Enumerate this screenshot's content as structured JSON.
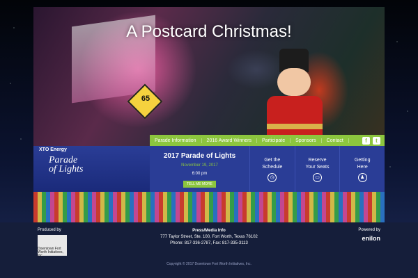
{
  "hero": {
    "title": "A Postcard Christmas!",
    "sign_number": "65"
  },
  "nav": {
    "items": [
      "Parade Information",
      "2016 Award Winners",
      "Participate",
      "Sponsors",
      "Contact"
    ],
    "social": [
      "f",
      "t"
    ]
  },
  "logo": {
    "sponsor": "XTO Energy",
    "name_line1": "Parade",
    "name_line2": "of Lights"
  },
  "event": {
    "title": "2017 Parade of Lights",
    "date": "November 19, 2017",
    "time": "6:00 pm",
    "button": "TELL ME MORE"
  },
  "tiles": [
    {
      "label1": "Get the",
      "label2": "Schedule",
      "icon": "clock-icon"
    },
    {
      "label1": "Reserve",
      "label2": "Your Seats",
      "icon": "ticket-icon"
    },
    {
      "label1": "Getting",
      "label2": "Here",
      "icon": "person-icon"
    }
  ],
  "footer": {
    "produced_by": "Produced by",
    "dfw": "Downtown Fort Worth Initiatives, Inc.",
    "press_title": "Press/Media Info",
    "address": "777 Taylor Street, Ste. 100, Fort Worth, Texas 76102",
    "phone": "Phone: 817-336-2787, Fax: 817-335-3113",
    "powered_by": "Powered by",
    "powered_brand": "enilon",
    "copyright": "Copyright © 2017 Downtown Fort Worth Initiatives, Inc."
  },
  "colors": {
    "accent_green": "#8cc63e",
    "panel_blue": "#2a3d96",
    "background": "#0b1226"
  }
}
